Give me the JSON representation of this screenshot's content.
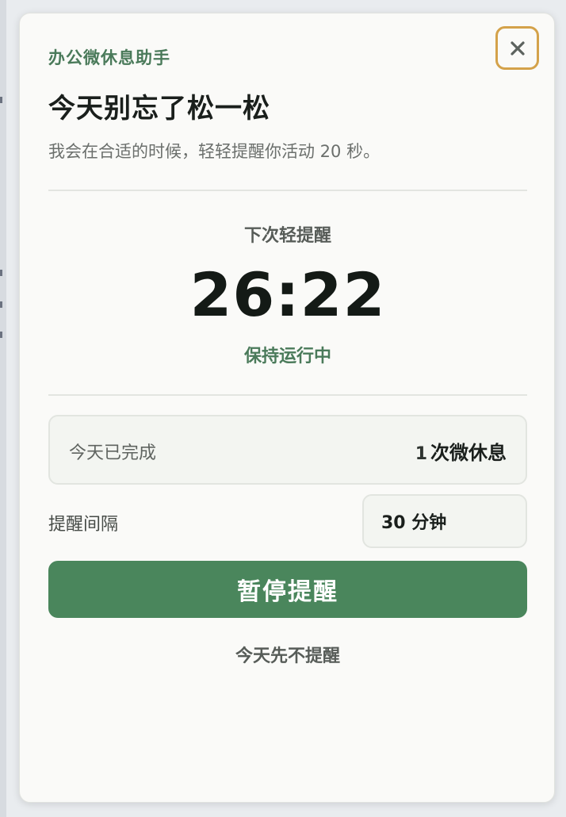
{
  "dialog": {
    "app_name": "办公微休息助手",
    "headline": "今天别忘了松一松",
    "subtitle": "我会在合适的时候，轻轻提醒你活动 20 秒。",
    "close_icon": "close-icon"
  },
  "timer": {
    "label": "下次轻提醒",
    "value": "26:22",
    "status": "保持运行中"
  },
  "stats": {
    "label": "今天已完成",
    "count": "1",
    "unit": "次微休息"
  },
  "interval": {
    "label": "提醒间隔",
    "selected": "30 分钟"
  },
  "actions": {
    "pause_label": "暂停提醒",
    "skip_today_label": "今天先不提醒"
  },
  "colors": {
    "accent_green": "#4a865c",
    "brand_green_text": "#4a7a5a",
    "focus_ring": "#d4a24a",
    "panel_bg": "#fafaf8"
  }
}
